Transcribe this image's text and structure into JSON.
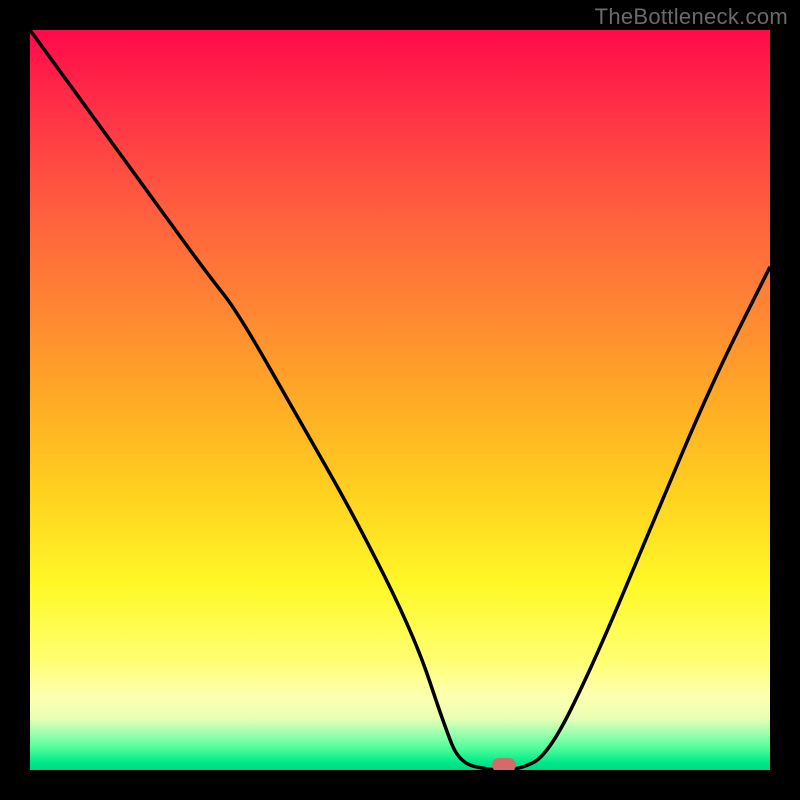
{
  "watermark": "TheBottleneck.com",
  "chart_data": {
    "type": "line",
    "title": "",
    "xlabel": "",
    "ylabel": "",
    "xlim": [
      0,
      100
    ],
    "ylim": [
      0,
      100
    ],
    "grid": false,
    "legend": false,
    "background": {
      "type": "vertical-gradient",
      "stops": [
        {
          "pct": 0,
          "color": "#ff0a4a"
        },
        {
          "pct": 22,
          "color": "#ff5740"
        },
        {
          "pct": 48,
          "color": "#ffa427"
        },
        {
          "pct": 75,
          "color": "#fff827"
        },
        {
          "pct": 90,
          "color": "#feffb0"
        },
        {
          "pct": 97,
          "color": "#4fff9a"
        },
        {
          "pct": 100,
          "color": "#00d884"
        }
      ]
    },
    "series": [
      {
        "name": "bottleneck-curve",
        "color": "#000000",
        "x": [
          0,
          8,
          16,
          24,
          28,
          36,
          44,
          52,
          56,
          58,
          62,
          66,
          70,
          76,
          84,
          92,
          100
        ],
        "values": [
          100,
          89,
          78,
          67,
          62,
          48,
          34,
          18,
          6,
          1,
          0,
          0,
          2,
          14,
          33,
          52,
          68
        ]
      }
    ],
    "marker": {
      "x": 64,
      "y": 0,
      "color": "#d36b6b"
    },
    "frame_stroke": "#000000",
    "frame_stroke_width": 30
  }
}
